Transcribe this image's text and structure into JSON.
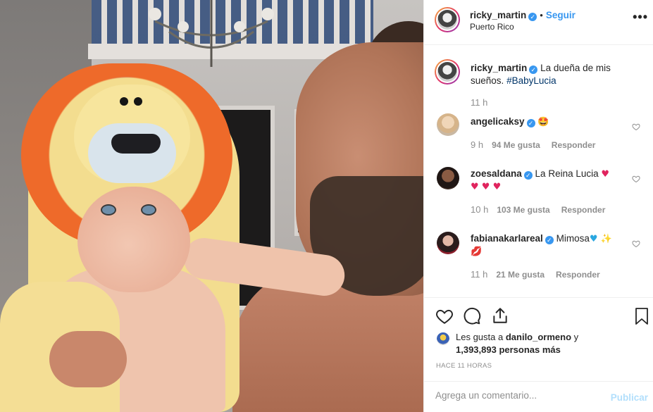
{
  "post": {
    "photo_alt": "Man holding baby in lion hooded towel",
    "author": "ricky_martin",
    "follow_label": "Seguir",
    "location": "Puerto Rico",
    "more_label": "•••"
  },
  "caption": {
    "username": "ricky_martin",
    "text": "La dueña de mis sueños.",
    "hashtag": "#BabyLucia",
    "time": "11 h"
  },
  "comments": [
    {
      "username": "angelicaksy",
      "text": "",
      "emoji": "🤩",
      "time": "9 h",
      "likes": "94 Me gusta",
      "reply": "Responder"
    },
    {
      "username": "zoesaldana",
      "text": "La Reina Lucia",
      "emoji": "♥",
      "emoji2": "♥ ♥ ♥",
      "time": "10 h",
      "likes": "103 Me gusta",
      "reply": "Responder"
    },
    {
      "username": "fabianakarlareal",
      "text": "Mimosa",
      "emoji": "♥ ✨",
      "emoji2": "💋",
      "time": "11 h",
      "likes": "21 Me gusta",
      "reply": "Responder"
    }
  ],
  "likes": {
    "prefix": "Les gusta a",
    "user": "danilo_ormeno",
    "and": "y",
    "count": "1,393,893 personas más"
  },
  "time_ago": "HACE 11 HORAS",
  "add_comment": {
    "placeholder": "Agrega un comentario...",
    "publish": "Publicar"
  },
  "colors": {
    "accent": "#3897f0",
    "hashtag": "#003569",
    "muted": "#8e8e8e",
    "heart_red": "#ed4956",
    "publish_disabled": "#b2dffc"
  },
  "icons": [
    "heart-icon",
    "comment-icon",
    "share-icon",
    "bookmark-icon",
    "verified-icon",
    "more-options-icon"
  ]
}
